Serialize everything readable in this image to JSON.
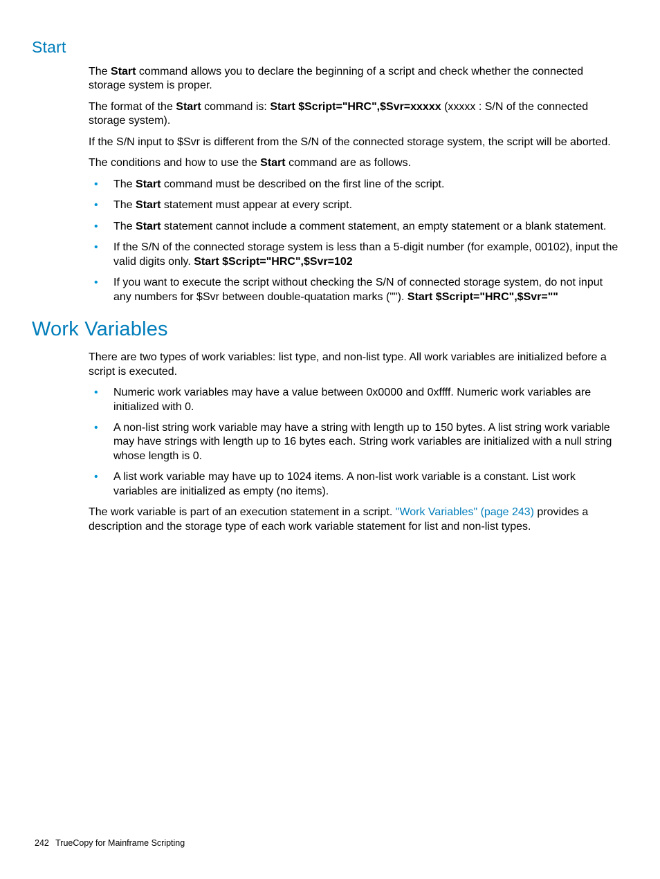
{
  "section1": {
    "heading": "Start",
    "p1a": "The ",
    "p1b": "Start",
    "p1c": " command allows you to declare the beginning of a script and check whether the connected storage system is proper.",
    "p2a": "The format of the ",
    "p2b": "Start",
    "p2c": " command is: ",
    "p2d": "Start $Script=\"HRC\",$Svr=xxxxx",
    "p2e": " (xxxxx : S/N of the connected storage system).",
    "p3": "If the S/N input to $Svr is different from the S/N of the connected storage system, the script will be aborted.",
    "p4a": "The conditions and how to use the ",
    "p4b": "Start",
    "p4c": " command are as follows.",
    "li1a": "The ",
    "li1b": "Start",
    "li1c": " command must be described on the first line of the script.",
    "li2a": "The ",
    "li2b": "Start",
    "li2c": " statement must appear at every script.",
    "li3a": "The ",
    "li3b": "Start",
    "li3c": " statement cannot include a comment statement, an empty statement or a blank statement.",
    "li4a": "If the S/N of the connected storage system is less than a 5-digit number (for example, 00102), input the valid digits only. ",
    "li4b": "Start $Script=\"HRC\",$Svr=102",
    "li5a": "If you want to execute the script without checking the S/N of connected storage system, do not input any numbers for $Svr between double-quatation marks (\"\"). ",
    "li5b": "Start $Script=\"HRC\",$Svr=\"\""
  },
  "section2": {
    "heading": "Work Variables",
    "p1": "There are two types of work variables: list type, and non-list type. All work variables are initialized before a script is executed.",
    "li1": "Numeric work variables may have a value between 0x0000 and 0xffff. Numeric work variables are initialized with 0.",
    "li2": "A non-list string work variable may have a string with length up to 150 bytes. A list string work variable may have strings with length up to 16 bytes each. String work variables are initialized with a null string whose length is 0.",
    "li3": "A list work variable may have up to 1024 items. A non-list work variable is a constant. List work variables are initialized as empty (no items).",
    "p2a": "The work variable is part of an execution statement in a script. ",
    "p2link": "\"Work Variables\" (page 243)",
    "p2b": " provides a description and the storage type of each work variable statement for list and non-list types."
  },
  "footer": {
    "pageNumber": "242",
    "title": "TrueCopy for Mainframe Scripting"
  }
}
